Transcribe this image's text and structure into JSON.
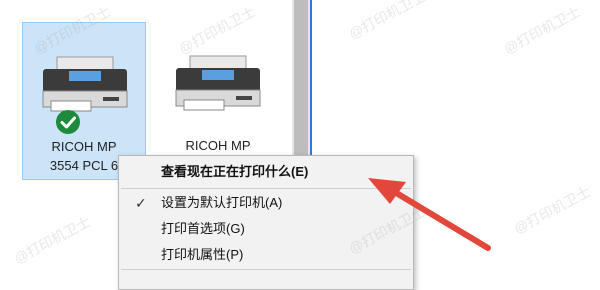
{
  "devices": [
    {
      "name_line1": "RICOH MP",
      "name_line2": "3554 PCL 6",
      "selected": true,
      "default": true
    },
    {
      "name_line1": "RICOH MP",
      "name_line2": "",
      "selected": false,
      "default": false
    }
  ],
  "context_menu": {
    "items": [
      {
        "label": "查看现在正在打印什么(E)",
        "bold": true,
        "checked": false
      },
      {
        "label": "设置为默认打印机(A)",
        "bold": false,
        "checked": true
      },
      {
        "label": "打印首选项(G)",
        "bold": false,
        "checked": false
      },
      {
        "label": "打印机属性(P)",
        "bold": false,
        "checked": false
      }
    ]
  },
  "watermark_text": "@打印机卫士",
  "colors": {
    "selection": "#cce4f7",
    "check_badge": "#1e8a3c",
    "arrow": "#e2473b"
  }
}
